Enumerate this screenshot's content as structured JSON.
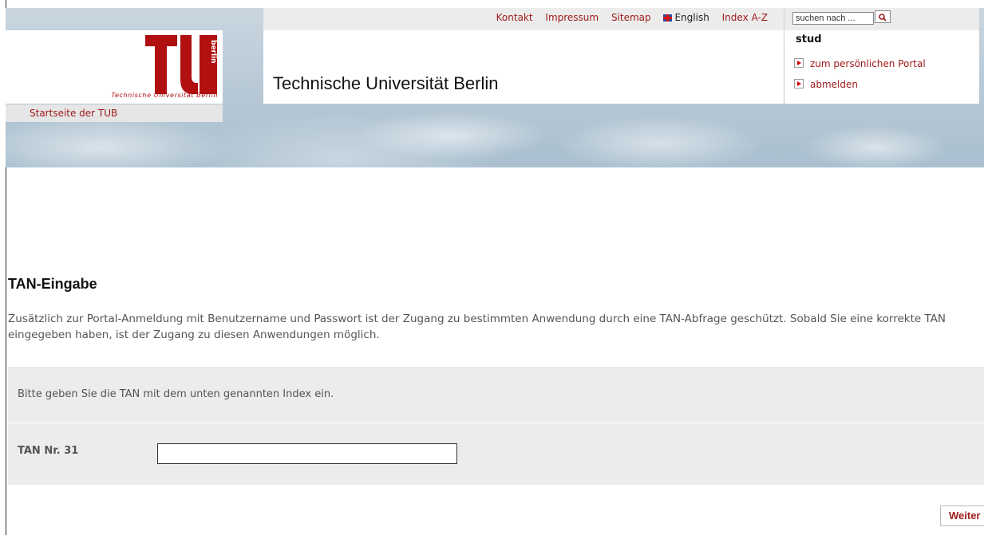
{
  "header": {
    "top_links": [
      "Kontakt",
      "Impressum",
      "Sitemap",
      "English",
      "Index A-Z"
    ],
    "search_placeholder": "suchen nach ...",
    "logo_subtitle": "Technische Universität Berlin",
    "logo_word": "berlin",
    "startseite": "Startseite der TUB",
    "site_title": "Technische Universität Berlin",
    "user": {
      "name": "stud",
      "portal_link": "zum persönlichen Portal",
      "logout_link": "abmelden"
    }
  },
  "main": {
    "heading": "TAN-Eingabe",
    "intro": "Zusätzlich zur Portal-Anmeldung mit Benutzername und Passwort ist der Zugang zu bestimmten Anwendung durch eine TAN-Abfrage geschützt. Sobald Sie eine korrekte TAN eingegeben haben, ist der Zugang zu diesen Anwendungen möglich.",
    "instruction": "Bitte geben Sie die TAN mit dem unten genannten Index ein.",
    "tan_label": "TAN Nr. 31",
    "tan_value": "",
    "submit_label": "Weiter"
  },
  "colors": {
    "brand_red": "#a01c1c",
    "logo_red": "#b01010",
    "panel_gray": "#ececec"
  }
}
